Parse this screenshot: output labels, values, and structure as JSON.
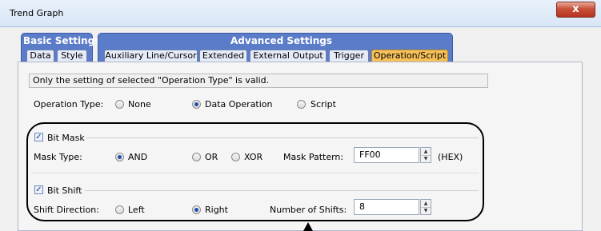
{
  "window": {
    "title": "Trend Graph",
    "close_glyph": "x"
  },
  "groups": {
    "basic": {
      "label": "Basic Settings",
      "tabs": [
        "Data",
        "Style"
      ]
    },
    "advanced": {
      "label": "Advanced Settings",
      "tabs": [
        "Auxiliary Line/Cursor",
        "Extended",
        "External Output",
        "Trigger",
        "Operation/Script"
      ]
    }
  },
  "active_tab": "Operation/Script",
  "info_text": "Only the setting of selected  \"Operation Type\" is valid.",
  "operation_type": {
    "label": "Operation Type:",
    "options": [
      "None",
      "Data Operation",
      "Script"
    ],
    "selected": "Data Operation"
  },
  "bit_mask": {
    "label": "Bit Mask",
    "checked": true,
    "mask_type_label": "Mask Type:",
    "mask_types": [
      "AND",
      "OR",
      "XOR"
    ],
    "selected": "AND",
    "pattern_label": "Mask Pattern:",
    "pattern_value": "FF00",
    "unit": "(HEX)"
  },
  "bit_shift": {
    "label": "Bit Shift",
    "checked": true,
    "direction_label": "Shift Direction:",
    "directions": [
      "Left",
      "Right"
    ],
    "selected": "Right",
    "shifts_label": "Number of Shifts:",
    "shifts_value": "8"
  },
  "colors": {
    "tab_group": "#5b7cc8",
    "active_tab": "#f6c15a",
    "close_button": "#c9503a"
  }
}
